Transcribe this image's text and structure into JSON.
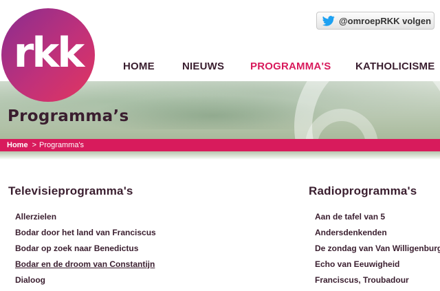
{
  "logo": {
    "text": "rkk"
  },
  "twitter": {
    "label": "@omroepRKK volgen",
    "icon": "twitter-bird-icon",
    "color": "#1da1f2"
  },
  "nav": [
    {
      "label": "HOME",
      "active": false
    },
    {
      "label": "NIEUWS",
      "active": false
    },
    {
      "label": "PROGRAMMA'S",
      "active": true
    },
    {
      "label": "KATHOLICISME",
      "active": false
    }
  ],
  "hero": {
    "title": "Programma’s"
  },
  "breadcrumb": {
    "home": "Home",
    "separator": ">",
    "current": "Programma's"
  },
  "tv": {
    "title": "Televisieprogramma's",
    "items": [
      "Allerzielen",
      "Bodar door het land van Franciscus",
      "Bodar op zoek naar Benedictus",
      "Bodar en de droom van Constantijn",
      "Dialoog"
    ]
  },
  "radio": {
    "title": "Radioprogramma's",
    "items": [
      "Aan de tafel van 5",
      "Andersdenkenden",
      "De zondag van Van Willigenburg",
      "Echo van Eeuwigheid",
      "Franciscus, Troubadour"
    ]
  },
  "colors": {
    "accent": "#d81b5c",
    "text": "#3a1e2f"
  }
}
